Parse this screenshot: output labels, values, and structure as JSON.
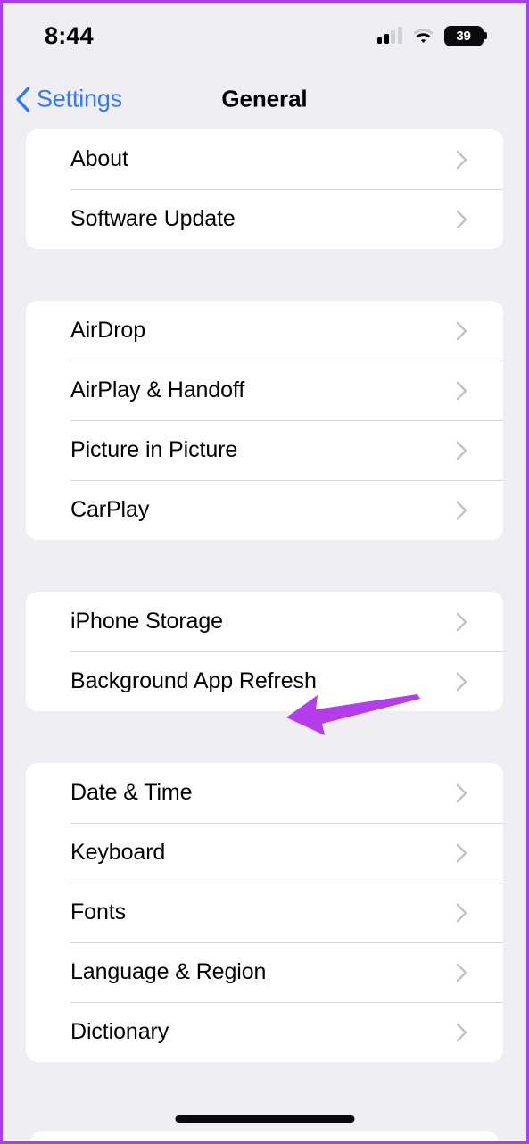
{
  "status_bar": {
    "time": "8:44",
    "signal_icon": "cellular-signal-icon",
    "signal_bars_filled": 2,
    "signal_bars_total": 4,
    "wifi_icon": "wifi-icon",
    "battery_icon": "battery-icon",
    "battery_level": "39"
  },
  "nav": {
    "back_icon": "chevron-left-icon",
    "back_label": "Settings",
    "title": "General"
  },
  "groups": [
    {
      "rows": [
        {
          "label": "About",
          "chevron": "chevron-right-icon"
        },
        {
          "label": "Software Update",
          "chevron": "chevron-right-icon"
        }
      ]
    },
    {
      "rows": [
        {
          "label": "AirDrop",
          "chevron": "chevron-right-icon"
        },
        {
          "label": "AirPlay & Handoff",
          "chevron": "chevron-right-icon"
        },
        {
          "label": "Picture in Picture",
          "chevron": "chevron-right-icon"
        },
        {
          "label": "CarPlay",
          "chevron": "chevron-right-icon"
        }
      ]
    },
    {
      "rows": [
        {
          "label": "iPhone Storage",
          "chevron": "chevron-right-icon"
        },
        {
          "label": "Background App Refresh",
          "chevron": "chevron-right-icon"
        }
      ]
    },
    {
      "rows": [
        {
          "label": "Date & Time",
          "chevron": "chevron-right-icon"
        },
        {
          "label": "Keyboard",
          "chevron": "chevron-right-icon"
        },
        {
          "label": "Fonts",
          "chevron": "chevron-right-icon"
        },
        {
          "label": "Language & Region",
          "chevron": "chevron-right-icon"
        },
        {
          "label": "Dictionary",
          "chevron": "chevron-right-icon"
        }
      ]
    }
  ],
  "annotation": {
    "icon": "arrow-left-annotation",
    "points_to": "Background App Refresh",
    "color": "#b43ceb"
  },
  "home_indicator": {
    "icon": "home-indicator"
  },
  "colors": {
    "background": "#eeeef3",
    "card": "#ffffff",
    "accent_blue": "#3578f6",
    "separator": "#d6d6da",
    "chevron_gray": "#c3c3c8",
    "border_purple": "#a93ef0",
    "annotation_purple": "#b43ceb"
  }
}
